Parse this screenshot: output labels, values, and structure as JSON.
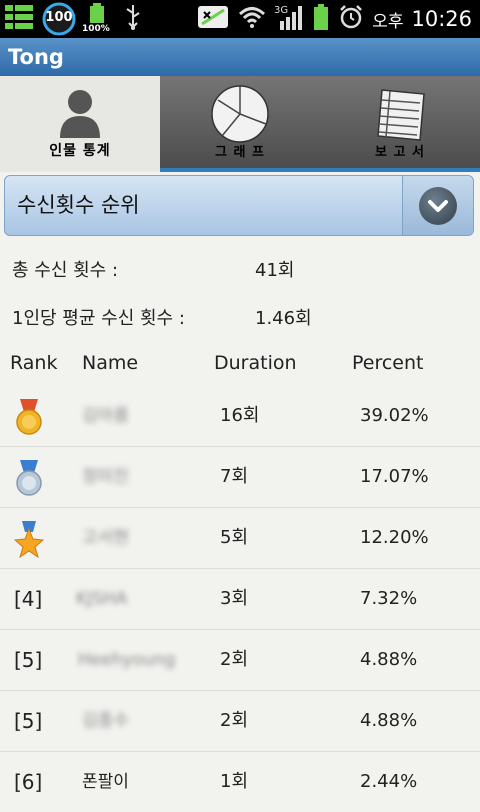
{
  "status": {
    "battery_badge": "100",
    "battery_percent": "100%",
    "ampm": "오후",
    "time": "10:26"
  },
  "app": {
    "title": "Tong"
  },
  "tabs": [
    {
      "label": "인물 통계",
      "icon": "person-icon",
      "active": true
    },
    {
      "label": "그 래 프",
      "icon": "pie-chart-icon",
      "active": false
    },
    {
      "label": "보 고 서",
      "icon": "report-icon",
      "active": false
    }
  ],
  "dropdown": {
    "selected": "수신횟수 순위"
  },
  "summary": {
    "total_label": "총 수신 횟수 :",
    "total_value": "41회",
    "avg_label": "1인당 평균 수신 횟수 :",
    "avg_value": "1.46회"
  },
  "table": {
    "headers": {
      "rank": "Rank",
      "name": "Name",
      "duration": "Duration",
      "percent": "Percent"
    },
    "rows": [
      {
        "rank": "",
        "medal": "gold",
        "name": "김아름",
        "blurred": true,
        "duration": "16회",
        "percent": "39.02%"
      },
      {
        "rank": "",
        "medal": "silver",
        "name": "정미진",
        "blurred": true,
        "duration": "7회",
        "percent": "17.07%"
      },
      {
        "rank": "",
        "medal": "star",
        "name": "고서현",
        "blurred": true,
        "duration": "5회",
        "percent": "12.20%"
      },
      {
        "rank": "[4]",
        "medal": "",
        "name": "KJSHA",
        "blurred": true,
        "duration": "3회",
        "percent": "7.32%"
      },
      {
        "rank": "[5]",
        "medal": "",
        "name": "Heehyoung",
        "blurred": true,
        "duration": "2회",
        "percent": "4.88%"
      },
      {
        "rank": "[5]",
        "medal": "",
        "name": "김종수",
        "blurred": true,
        "duration": "2회",
        "percent": "4.88%"
      },
      {
        "rank": "[6]",
        "medal": "",
        "name": "폰팔이",
        "blurred": false,
        "duration": "1회",
        "percent": "2.44%"
      }
    ]
  },
  "colors": {
    "titlebar": "#2e6aa8",
    "tab_underline": "#2f7fc0",
    "dropdown": "#a8c5e3",
    "medal_gold": "#f0b429",
    "medal_silver": "#b6c7d6",
    "medal_star": "#f5a623"
  }
}
